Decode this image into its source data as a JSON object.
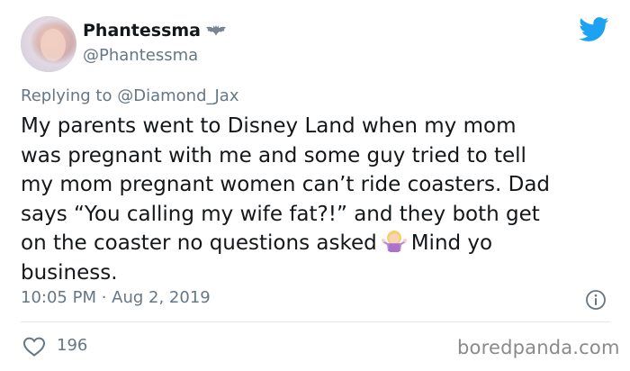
{
  "author": {
    "display_name": "Phantessma",
    "handle": "@Phantessma",
    "badge_icon": "bat-icon"
  },
  "brand": {
    "icon": "twitter-bird-icon",
    "color": "#1da1f2"
  },
  "reply": {
    "prefix": "Replying to",
    "mention": "@Diamond_Jax"
  },
  "tweet": {
    "lines": [
      "My parents went to Disney Land when my mom",
      "was pregnant with me and some guy tried to tell",
      "my mom pregnant women can’t ride coasters. Dad",
      "says “You calling my wife fat?!” and they both get",
      "on the coaster no questions asked",
      "Mind yo",
      "business."
    ],
    "emoji": "woman-shrugging-emoji"
  },
  "meta": {
    "timestamp": "10:05 PM · Aug 2, 2019",
    "info_icon": "info-icon"
  },
  "engagement": {
    "like_icon": "heart-icon",
    "likes": "196"
  },
  "watermark": "boredpanda.com",
  "colors": {
    "text": "#14171a",
    "secondary": "#657786",
    "divider": "#e1e8ed"
  }
}
